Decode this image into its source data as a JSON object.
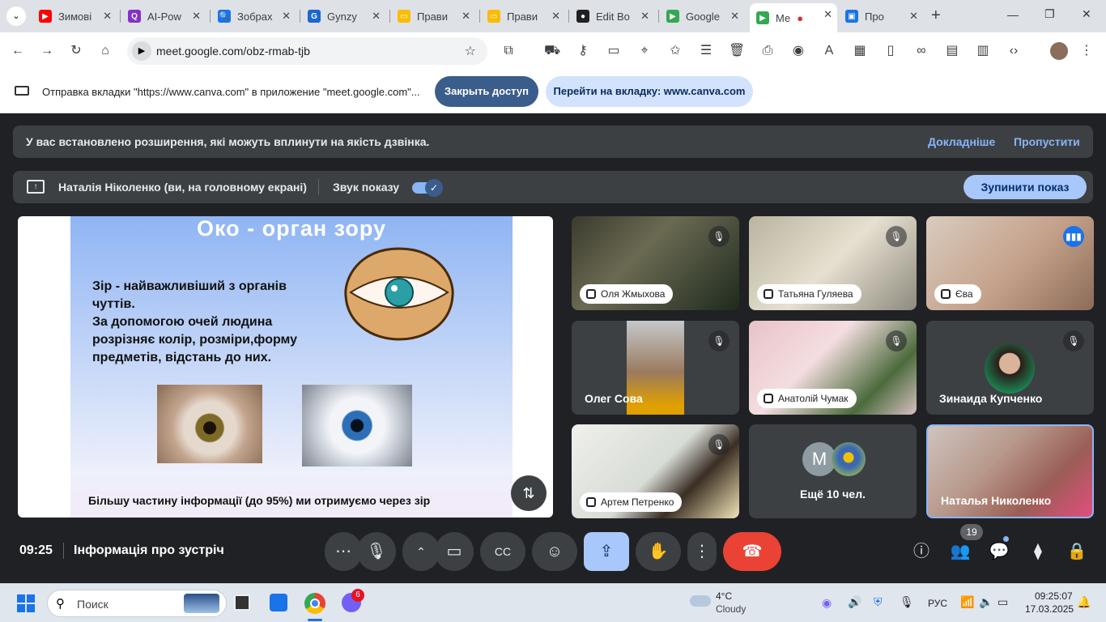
{
  "tabs": [
    {
      "label": "Зимові",
      "fav": "#ff0000",
      "glyph": "▶"
    },
    {
      "label": "AI-Pow",
      "fav": "#8430ce",
      "glyph": "Q"
    },
    {
      "label": "Зобрах",
      "fav": "#1a73e8",
      "glyph": "🔍"
    },
    {
      "label": "Gynzy",
      "fav": "#1967d2",
      "glyph": "G"
    },
    {
      "label": "Прави",
      "fav": "#fbbc04",
      "glyph": "▭"
    },
    {
      "label": "Прави",
      "fav": "#fbbc04",
      "glyph": "▭"
    },
    {
      "label": "Edit Bo",
      "fav": "#202124",
      "glyph": "●"
    },
    {
      "label": "Google",
      "fav": "#34a853",
      "glyph": "▶"
    },
    {
      "label": "Ме",
      "fav": "#34a853",
      "glyph": "▶",
      "rec": "●"
    },
    {
      "label": "Про",
      "fav": "#1a73e8",
      "glyph": "▣"
    }
  ],
  "new_tab": "+",
  "window": {
    "minimize": "—",
    "maximize": "❐",
    "close": "✕"
  },
  "url": "meet.google.com/obz-rmab-tjb",
  "infobar": {
    "text": "Отправка вкладки \"https://www.canva.com\" в приложение \"meet.google.com\"...",
    "stop": "Закрыть доступ",
    "switch": "Перейти на вкладку: www.canva.com"
  },
  "ext_banner": {
    "text": "У вас встановлено розширення, які можуть вплинути на якість дзвінка.",
    "more": "Докладніше",
    "skip": "Пропустити"
  },
  "share_bar": {
    "presenter": "Наталія Ніколенко (ви, на головному екрані)",
    "audio": "Звук показу",
    "stop": "Зупинити показ"
  },
  "slide": {
    "title": "Око - орган зору",
    "body": [
      "Зір - найважливіший з органів",
      "чуттів.",
      "За допомогою очей людина",
      "розрізняє колір, розміри,форму",
      "предметів, відстань до них."
    ],
    "footer": "Більшу частину інформації (до 95%) ми отримуємо через зір"
  },
  "participants": [
    {
      "name": "Оля Жмыхова",
      "style": "pill",
      "muted": true
    },
    {
      "name": "Татьяна Гуляева",
      "style": "pill",
      "muted": true
    },
    {
      "name": "Єва",
      "style": "pill",
      "speaking": true
    },
    {
      "name": "Олег Сова",
      "style": "plain",
      "muted": true
    },
    {
      "name": "Анатолій Чумак",
      "style": "pill",
      "muted": true
    },
    {
      "name": "Зинаида Купченко",
      "style": "plain",
      "muted": true
    },
    {
      "name": "Артем Петренко",
      "style": "pill",
      "muted": true
    },
    {
      "name": "Ещё 10 чел.",
      "style": "more",
      "avatar_letter": "M"
    },
    {
      "name": "Наталья Николенко",
      "style": "plain",
      "self": true
    }
  ],
  "bottom": {
    "time": "09:25",
    "title": "Інформація про зустріч",
    "people_count": "19"
  },
  "taskbar": {
    "search": "Поиск",
    "badge": "6",
    "temp": "4°C",
    "weather": "Cloudy",
    "lang": "РУС",
    "clock": "09:25:07",
    "date": "17.03.2025"
  }
}
